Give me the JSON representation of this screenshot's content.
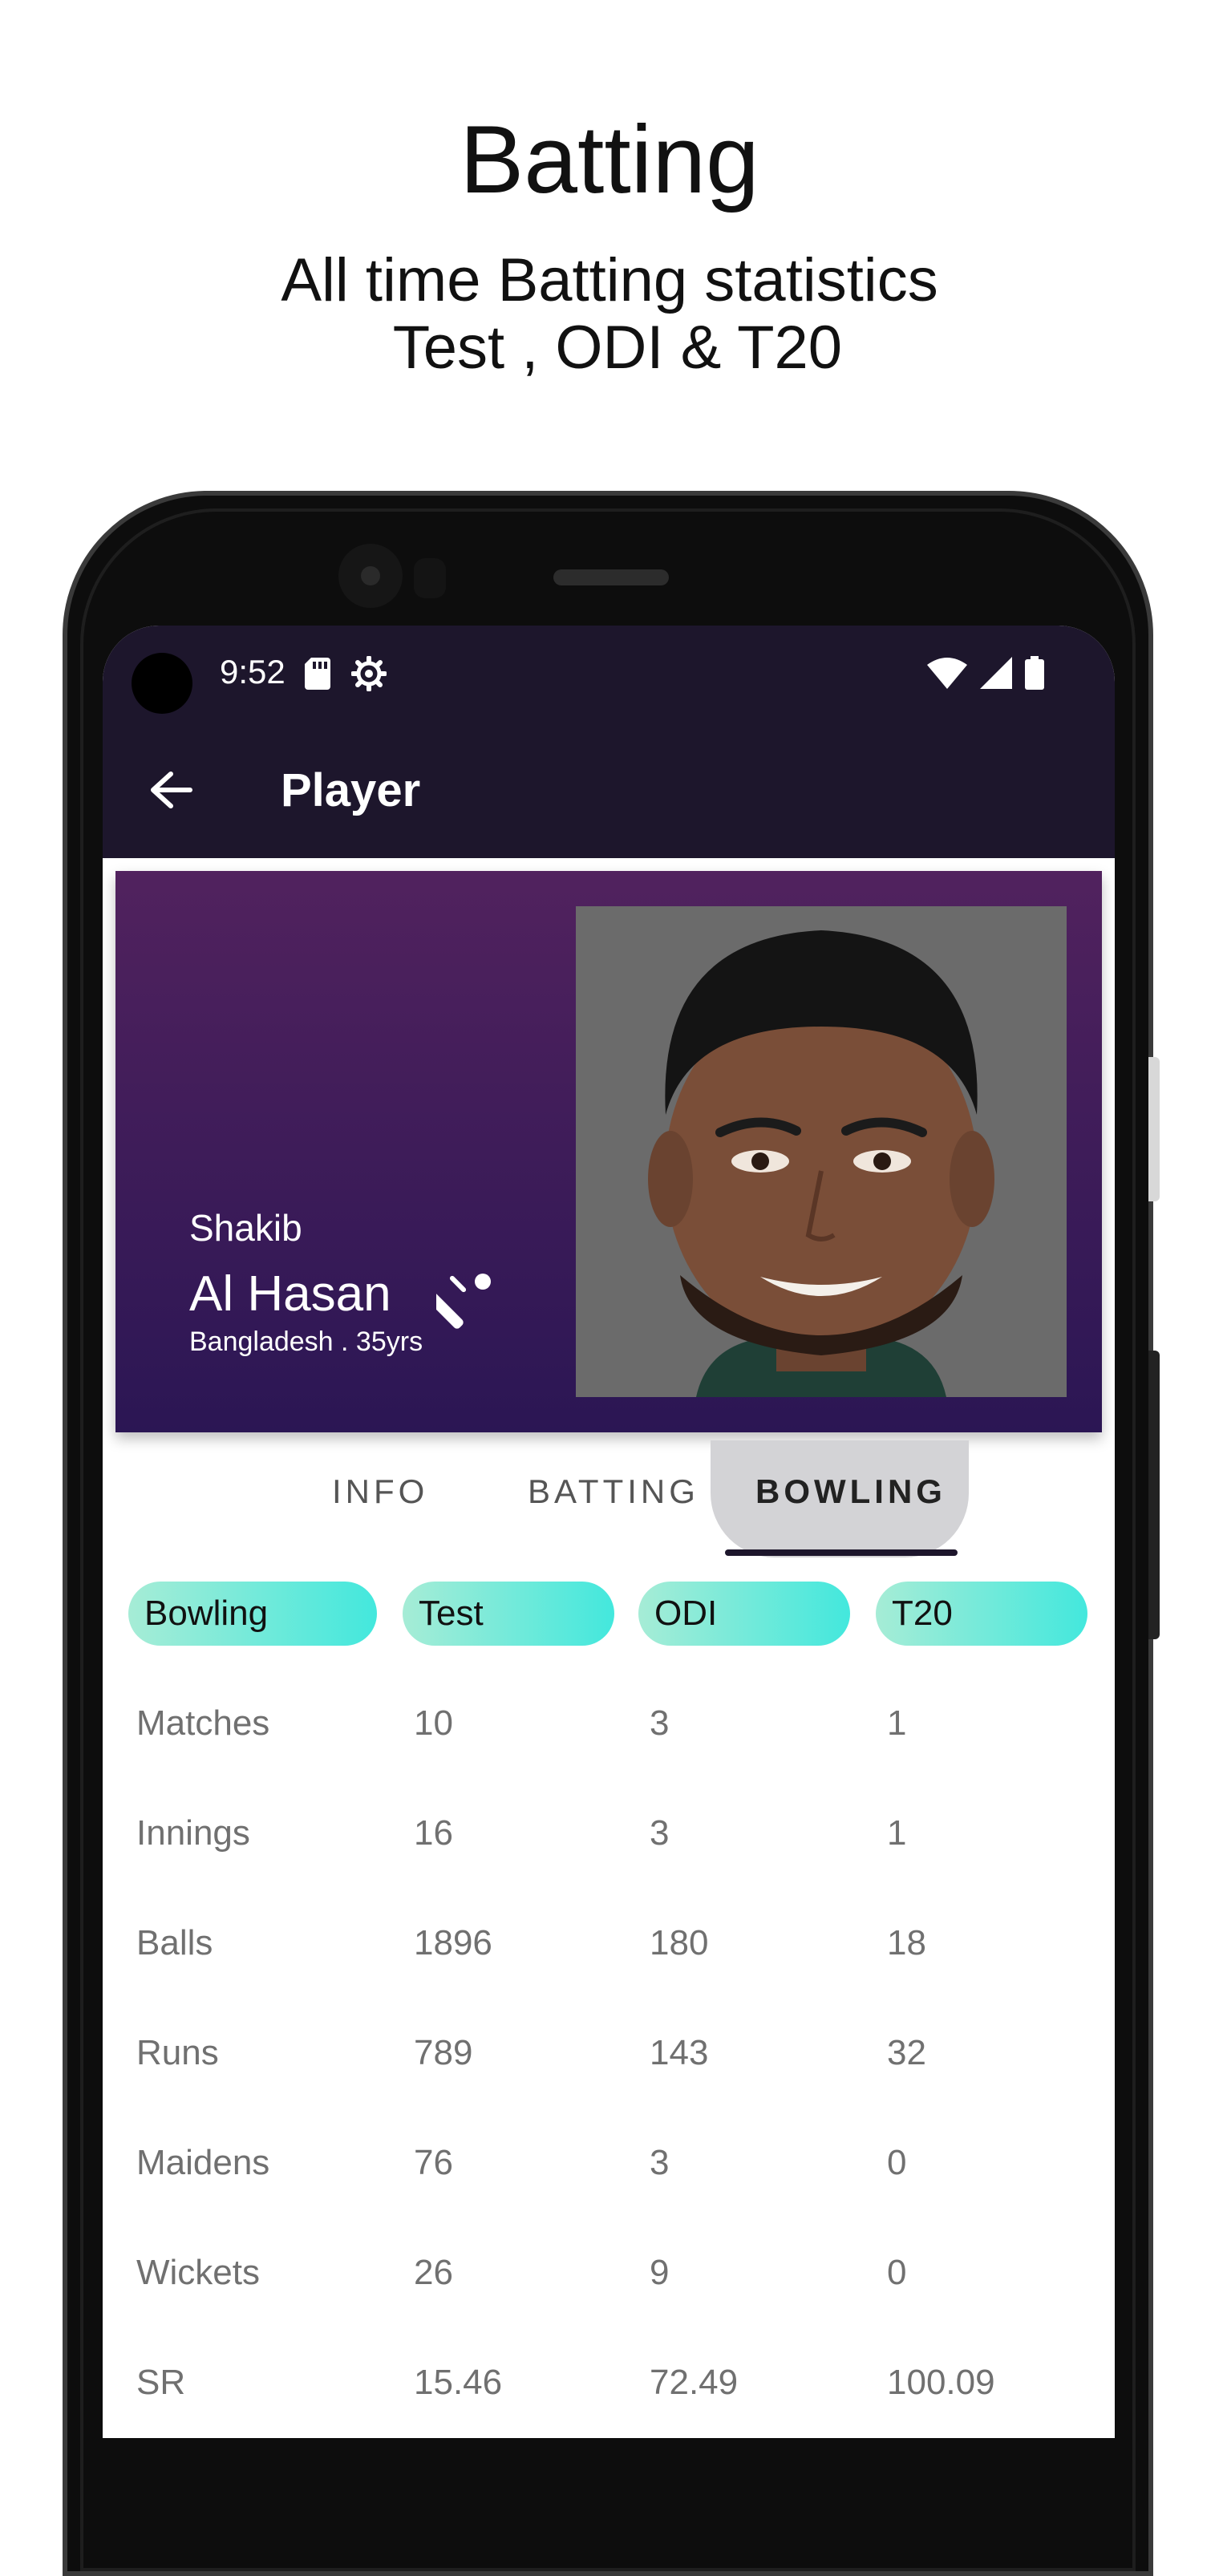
{
  "promo": {
    "title": "Batting",
    "subtitle_line1": "All time Batting statistics",
    "subtitle_line2": " Test , ODI & T20"
  },
  "status_bar": {
    "time": "9:52",
    "icons": [
      "sd-card-icon",
      "gear-icon",
      "wifi-icon",
      "signal-icon",
      "battery-icon"
    ]
  },
  "app_bar": {
    "back_icon": "arrow-left-icon",
    "title": "Player"
  },
  "player": {
    "first_name": "Shakib",
    "last_name": "Al Hasan",
    "meta": "Bangladesh . 35yrs",
    "role_icon": "cricket-bat-icon"
  },
  "tabs": {
    "items": [
      "INFO",
      "BATTING",
      "BOWLING"
    ],
    "selected": "BOWLING"
  },
  "stats_table": {
    "headers": [
      "Bowling",
      "Test",
      "ODI",
      "T20"
    ],
    "rows": [
      [
        "Matches",
        "10",
        "3",
        "1"
      ],
      [
        "Innings",
        "16",
        "3",
        "1"
      ],
      [
        "Balls",
        "1896",
        "180",
        "18"
      ],
      [
        "Runs",
        "789",
        "143",
        "32"
      ],
      [
        "Maidens",
        "76",
        "3",
        "0"
      ],
      [
        "Wickets",
        "26",
        "9",
        "0"
      ],
      [
        "SR",
        "15.46",
        "72.49",
        "100.09"
      ]
    ]
  },
  "colors": {
    "app_bar": "#1d162c",
    "card_top": "#51225e",
    "card_bottom": "#2b1654",
    "pill_start": "#a6ecd6",
    "pill_end": "#43e8dd"
  }
}
